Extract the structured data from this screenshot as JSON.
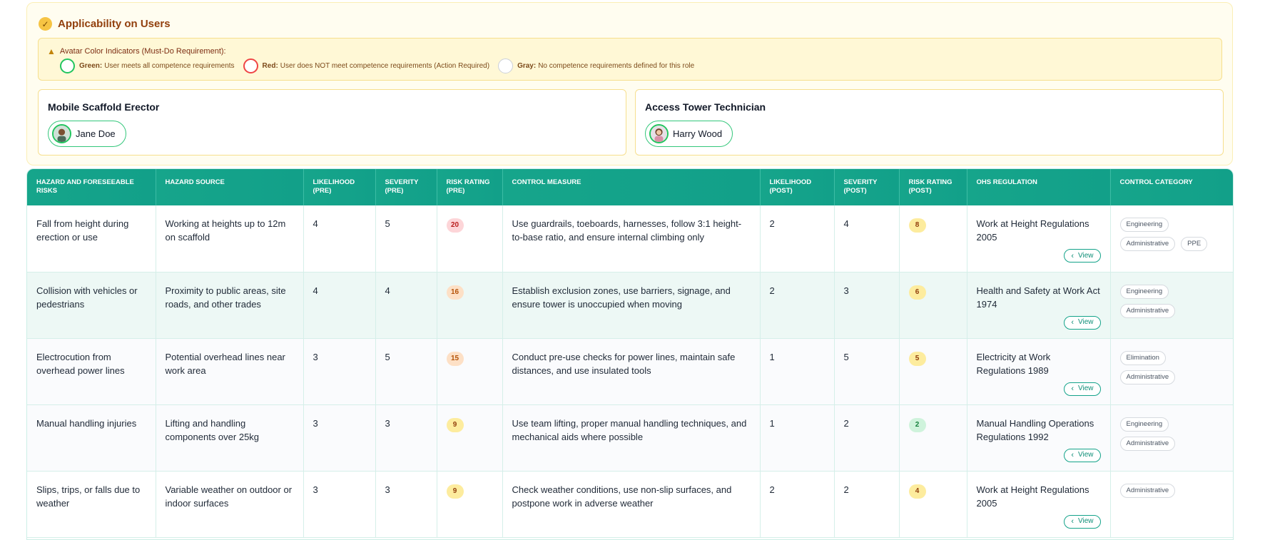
{
  "applicability": {
    "title": "Applicability on Users",
    "legend": {
      "heading": "Avatar Color Indicators (Must-Do Requirement):",
      "items": [
        {
          "label": "Green:",
          "text": "User meets all competence requirements",
          "color": "#22c55e"
        },
        {
          "label": "Red:",
          "text": "User does NOT meet competence requirements (Action Required)",
          "color": "#ef4444"
        },
        {
          "label": "Gray:",
          "text": "No competence requirements defined for this role",
          "color": "#cbd0d8"
        }
      ]
    },
    "roles": [
      {
        "title": "Mobile Scaffold Erector",
        "user": "Jane Doe"
      },
      {
        "title": "Access Tower Technician",
        "user": "Harry Wood"
      }
    ]
  },
  "table": {
    "headers": [
      "Hazard and Foreseeable Risks",
      "Hazard Source",
      "Likelihood (Pre)",
      "Severity (Pre)",
      "Risk Rating (Pre)",
      "Control Measure",
      "Likelihood (Post)",
      "Severity (Post)",
      "Risk Rating (Post)",
      "OHS Regulation",
      "Control Category"
    ],
    "view_label": "View",
    "rows": [
      {
        "hazard": "Fall from height during erection or use",
        "source": "Working at heights up to 12m on scaffold",
        "likelihood_pre": "4",
        "severity_pre": "5",
        "rating_pre": "20",
        "control": "Use guardrails, toeboards, harnesses, follow 3:1 height-to-base ratio, and ensure internal climbing only",
        "likelihood_post": "2",
        "severity_post": "4",
        "rating_post": "8",
        "regulation": "Work at Height Regulations 2005",
        "categories": [
          "Engineering",
          "Administrative",
          "PPE"
        ]
      },
      {
        "hazard": "Collision with vehicles or pedestrians",
        "source": "Proximity to public areas, site roads, and other trades",
        "likelihood_pre": "4",
        "severity_pre": "4",
        "rating_pre": "16",
        "control": "Establish exclusion zones, use barriers, signage, and ensure tower is unoccupied when moving",
        "likelihood_post": "2",
        "severity_post": "3",
        "rating_post": "6",
        "regulation": "Health and Safety at Work Act 1974",
        "categories": [
          "Engineering",
          "Administrative"
        ]
      },
      {
        "hazard": "Electrocution from overhead power lines",
        "source": "Potential overhead lines near work area",
        "likelihood_pre": "3",
        "severity_pre": "5",
        "rating_pre": "15",
        "control": "Conduct pre-use checks for power lines, maintain safe distances, and use insulated tools",
        "likelihood_post": "1",
        "severity_post": "5",
        "rating_post": "5",
        "regulation": "Electricity at Work Regulations 1989",
        "categories": [
          "Elimination",
          "Administrative"
        ]
      },
      {
        "hazard": "Manual handling injuries",
        "source": "Lifting and handling components over 25kg",
        "likelihood_pre": "3",
        "severity_pre": "3",
        "rating_pre": "9",
        "control": "Use team lifting, proper manual handling techniques, and mechanical aids where possible",
        "likelihood_post": "1",
        "severity_post": "2",
        "rating_post": "2",
        "regulation": "Manual Handling Operations Regulations 1992",
        "categories": [
          "Engineering",
          "Administrative"
        ]
      },
      {
        "hazard": "Slips, trips, or falls due to weather",
        "source": "Variable weather on outdoor or indoor surfaces",
        "likelihood_pre": "3",
        "severity_pre": "3",
        "rating_pre": "9",
        "control": "Check weather conditions, use non-slip surfaces, and postpone work in adverse weather",
        "likelihood_post": "2",
        "severity_post": "2",
        "rating_post": "4",
        "regulation": "Work at Height Regulations 2005",
        "categories": [
          "Administrative"
        ]
      }
    ]
  },
  "colors": {
    "header_teal": "#16a58b",
    "rating_high_bg": "#fdd5d8",
    "rating_high_fg": "#b91c1c",
    "rating_medhigh_bg": "#fde0c6",
    "rating_medhigh_fg": "#b45309",
    "rating_med_bg": "#fdec9e",
    "rating_med_fg": "#92400e",
    "rating_low_bg": "#cff3dc",
    "rating_low_fg": "#15803d"
  }
}
